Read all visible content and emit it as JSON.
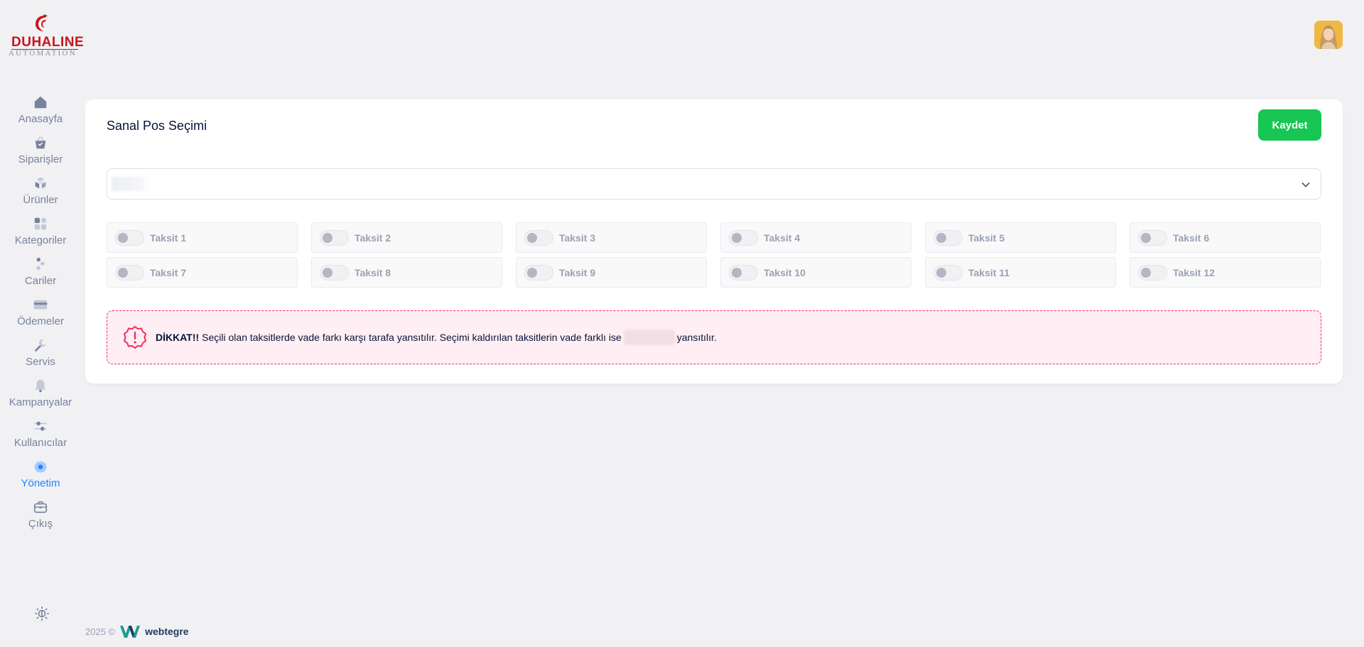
{
  "brand": {
    "name": "DUHALINE",
    "tagline": "AUTOMATION",
    "primary_color": "#c8151d"
  },
  "user": {
    "avatar_icon": "user-avatar"
  },
  "sidebar": {
    "items": [
      {
        "label": "Anasayfa",
        "icon": "home-icon",
        "active": false
      },
      {
        "label": "Siparişler",
        "icon": "basket-icon",
        "active": false
      },
      {
        "label": "Ürünler",
        "icon": "boxes-icon",
        "active": false
      },
      {
        "label": "Kategoriler",
        "icon": "category-icon",
        "active": false
      },
      {
        "label": "Cariler",
        "icon": "people-icon",
        "active": false
      },
      {
        "label": "Ödemeler",
        "icon": "credit-card-icon",
        "active": false
      },
      {
        "label": "Servis",
        "icon": "wrench-icon",
        "active": false
      },
      {
        "label": "Kampanyalar",
        "icon": "notification-icon",
        "active": false
      },
      {
        "label": "Kullanıcılar",
        "icon": "sliders-icon",
        "active": false
      },
      {
        "label": "Yönetim",
        "icon": "gear-icon",
        "active": true
      },
      {
        "label": "Çıkış",
        "icon": "briefcase-icon",
        "active": false
      }
    ],
    "active_color": "#1b84ff"
  },
  "card": {
    "title": "Sanal Pos Seçimi",
    "save_label": "Kaydet",
    "save_color": "#17c653"
  },
  "installments": [
    {
      "label": "Taksit 1",
      "checked": false
    },
    {
      "label": "Taksit 2",
      "checked": false
    },
    {
      "label": "Taksit 3",
      "checked": false
    },
    {
      "label": "Taksit 4",
      "checked": false
    },
    {
      "label": "Taksit 5",
      "checked": false
    },
    {
      "label": "Taksit 6",
      "checked": false
    },
    {
      "label": "Taksit 7",
      "checked": false
    },
    {
      "label": "Taksit 8",
      "checked": false
    },
    {
      "label": "Taksit 9",
      "checked": false
    },
    {
      "label": "Taksit 10",
      "checked": false
    },
    {
      "label": "Taksit 11",
      "checked": false
    },
    {
      "label": "Taksit 12",
      "checked": false
    }
  ],
  "alert": {
    "strong": "DİKKAT!!",
    "text_before": "Seçili olan taksitlerde vade farkı karşı tarafa yansıtılır. Seçimi kaldırılan taksitlerin vade farklı ise",
    "text_after": "yansıtılır.",
    "color": "#f8285a"
  },
  "footer": {
    "copyright": "2025 ©",
    "brand": "webtegre"
  }
}
